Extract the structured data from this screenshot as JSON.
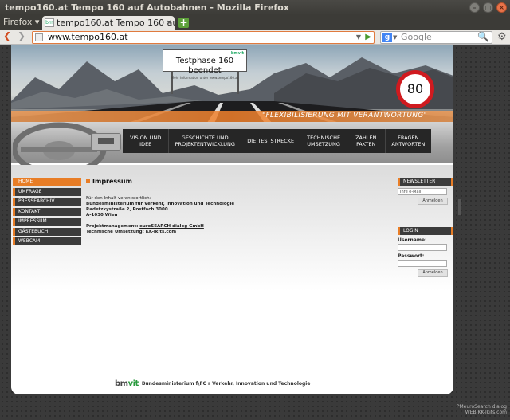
{
  "window": {
    "title": "tempo160.at Tempo 160 auf Autobahnen - Mozilla Firefox",
    "minimize": "–",
    "maximize": "□",
    "close": "×"
  },
  "tabs": {
    "firefox_menu": "Firefox ▾",
    "active_tab": "tempo160.at Tempo 160 auf A…",
    "favicon_text": "bm",
    "close": "×",
    "new_tab": "+"
  },
  "nav": {
    "back": "❮",
    "forward": "❯",
    "url": "www.tempo160.at",
    "url_dropdown": "▼",
    "go": "▶",
    "search_placeholder": "Google",
    "search_engine": "g",
    "search_dropdown": "▼",
    "search_button": "🔍",
    "tools": "⚙"
  },
  "site": {
    "billboard": {
      "logo": "bmvit",
      "title": "Testphase 160 beendet",
      "subtitle": "Mehr Information unter www.tempo160.at"
    },
    "speed_sign": "80",
    "slogan": "\"FLEXIBILISIERUNG MIT VERANTWORTUNG\"",
    "main_nav": [
      {
        "label": "VISION UND IDEE"
      },
      {
        "label": "GESCHICHTE UND PROJEKTENTWICKLUNG"
      },
      {
        "label": "DIE TESTSTRECKE"
      },
      {
        "label": "TECHNISCHE UMSETZUNG"
      },
      {
        "label": "ZAHLEN FAKTEN"
      },
      {
        "label": "FRAGEN ANTWORTEN"
      }
    ],
    "left_nav": [
      {
        "label": "HOME",
        "active": true
      },
      {
        "label": "UMFRAGE",
        "active": false
      },
      {
        "label": "PRESSEARCHIV",
        "active": false
      },
      {
        "label": "KONTAKT",
        "active": false
      },
      {
        "label": "IMPRESSUM",
        "active": false
      },
      {
        "label": "GÄSTEBUCH",
        "active": false
      },
      {
        "label": "WEBCAM",
        "active": false
      }
    ],
    "content": {
      "title": "Impressum",
      "responsible_label": "Für den Inhalt verantwortlich:",
      "ministry": "Bundesministerium für Verkehr, Innovation und Technologie",
      "street": "Radetzkystraße 2, Postfach 3000",
      "city": "A-1030 Wien",
      "pm_label": "Projektmanagement:",
      "pm_link": "euroSEARCH dialog GmbH",
      "tech_label": "Technische Umsetzung:",
      "tech_link": "KK-lkits.com"
    },
    "newsletter": {
      "heading": "NEWSLETTER",
      "email_placeholder": "Ihre e-Mail",
      "submit": "Anmelden"
    },
    "login": {
      "heading": "LOGIN",
      "username_label": "Username:",
      "password_label": "Passwort:",
      "submit": "Anmelden"
    },
    "footer": {
      "logo_bm": "bm",
      "logo_vit": "vit",
      "text": "Bundesministerium f\\FC r Verkehr, Innovation und Technologie"
    }
  },
  "watermark": {
    "line1": "PMeuroSearch dialog",
    "line2": "WEB:KK-lkits.com"
  }
}
